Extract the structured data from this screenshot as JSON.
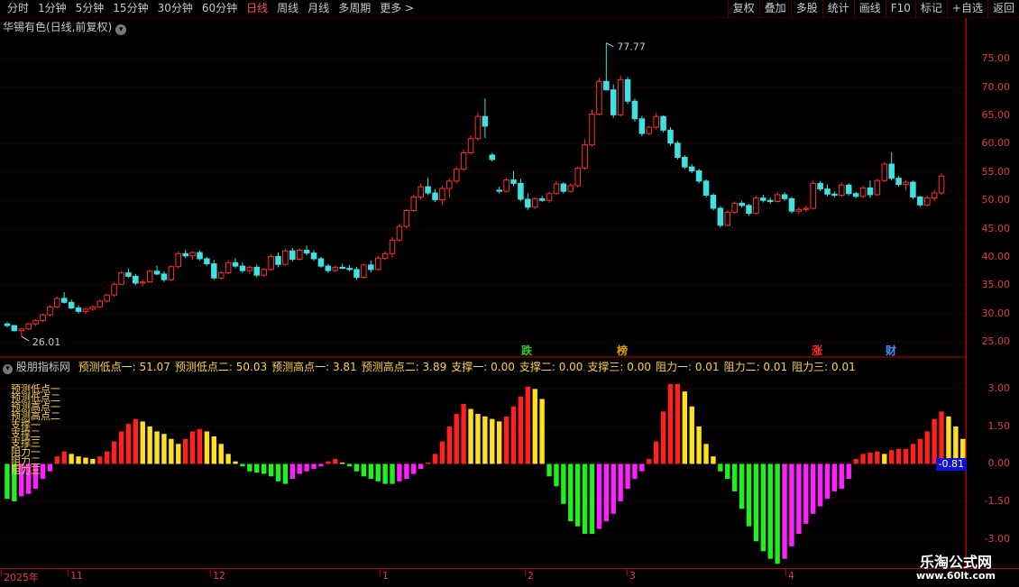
{
  "toolbar": {
    "periods": [
      "分时",
      "1分钟",
      "5分钟",
      "15分钟",
      "30分钟",
      "60分钟",
      "日线",
      "周线",
      "月线",
      "多周期",
      "更多 >"
    ],
    "active_period": "日线",
    "right_buttons": [
      "复权",
      "叠加",
      "多股",
      "统计",
      "画线",
      "F10",
      "标记",
      "+自选",
      "返回"
    ]
  },
  "chart_title": "华锡有色(日线,前复权)",
  "indicator": {
    "name": "股朋指标网",
    "values": [
      {
        "k": "预测低点一",
        "v": "51.07"
      },
      {
        "k": "预测低点二",
        "v": "50.03"
      },
      {
        "k": "预测高点一",
        "v": "3.81"
      },
      {
        "k": "预测高点二",
        "v": "3.89"
      },
      {
        "k": "支撑一",
        "v": "0.00"
      },
      {
        "k": "支撑二",
        "v": "0.00"
      },
      {
        "k": "支撑三",
        "v": "0.00"
      },
      {
        "k": "阻力一",
        "v": "0.01"
      },
      {
        "k": "阻力二",
        "v": "0.01"
      },
      {
        "k": "阻力三",
        "v": "0.01"
      }
    ],
    "current": "-0.81"
  },
  "price_axis": [
    "75.00",
    "70.00",
    "65.00",
    "60.00",
    "55.00",
    "50.00",
    "45.00",
    "40.00",
    "35.00",
    "30.00",
    "25.00"
  ],
  "ind_axis": [
    "3.00",
    "1.50",
    "0.00",
    "-1.50",
    "-3.00"
  ],
  "annotations": {
    "high": "77.77",
    "low": "26.01"
  },
  "event_tags": [
    {
      "text": "跌",
      "color": "#30d030"
    },
    {
      "text": "榜",
      "color": "#e0a000"
    },
    {
      "text": "涨",
      "color": "#ff3030"
    },
    {
      "text": "财",
      "color": "#4090ff"
    }
  ],
  "x_labels": [
    "2025年",
    "11",
    "12",
    "1",
    "2",
    "3",
    "4"
  ],
  "watermark": {
    "line1": "乐淘公式网",
    "line2": "www.60lt.com"
  },
  "colors": {
    "up": "#ff3030",
    "down": "#40e0e0",
    "grid": "#6a0000"
  },
  "chart_data": {
    "type": "candlestick",
    "ohlc": [
      [
        28.2,
        28.5,
        27.6,
        27.9
      ],
      [
        27.9,
        28.0,
        26.9,
        27.0
      ],
      [
        27.0,
        27.5,
        26.01,
        27.3
      ],
      [
        27.3,
        28.4,
        27.1,
        28.2
      ],
      [
        28.2,
        29.0,
        27.8,
        28.8
      ],
      [
        28.8,
        30.0,
        28.5,
        29.8
      ],
      [
        29.8,
        31.5,
        29.5,
        31.2
      ],
      [
        31.2,
        33.0,
        31.0,
        32.7
      ],
      [
        32.7,
        33.8,
        31.8,
        32.0
      ],
      [
        32.0,
        32.5,
        30.8,
        31.0
      ],
      [
        31.0,
        31.5,
        30.0,
        30.4
      ],
      [
        30.4,
        31.0,
        30.0,
        30.8
      ],
      [
        30.8,
        31.5,
        30.5,
        31.2
      ],
      [
        31.2,
        32.5,
        31.0,
        32.2
      ],
      [
        32.2,
        33.5,
        32.0,
        33.3
      ],
      [
        33.3,
        35.5,
        33.0,
        35.2
      ],
      [
        35.2,
        37.5,
        35.0,
        37.2
      ],
      [
        37.2,
        38.0,
        36.3,
        36.6
      ],
      [
        36.6,
        37.0,
        35.0,
        35.4
      ],
      [
        35.4,
        36.0,
        34.8,
        35.6
      ],
      [
        35.6,
        37.8,
        35.4,
        37.5
      ],
      [
        37.5,
        38.5,
        36.8,
        37.0
      ],
      [
        37.0,
        37.5,
        35.6,
        36.0
      ],
      [
        36.0,
        38.5,
        35.8,
        38.3
      ],
      [
        38.3,
        41.0,
        38.0,
        40.6
      ],
      [
        40.6,
        41.3,
        39.8,
        40.2
      ],
      [
        40.2,
        41.0,
        39.5,
        40.8
      ],
      [
        40.8,
        41.2,
        39.4,
        39.7
      ],
      [
        39.7,
        40.0,
        38.5,
        38.8
      ],
      [
        38.8,
        39.5,
        36.0,
        36.3
      ],
      [
        36.3,
        37.5,
        36.0,
        37.2
      ],
      [
        37.2,
        39.5,
        37.0,
        39.0
      ],
      [
        39.0,
        39.8,
        38.0,
        38.4
      ],
      [
        38.4,
        39.0,
        37.2,
        37.6
      ],
      [
        37.6,
        38.5,
        37.0,
        38.2
      ],
      [
        38.2,
        38.7,
        36.4,
        36.8
      ],
      [
        36.8,
        38.0,
        36.5,
        37.8
      ],
      [
        37.8,
        40.5,
        37.6,
        40.1
      ],
      [
        40.1,
        40.8,
        38.2,
        38.7
      ],
      [
        38.7,
        41.5,
        38.5,
        41.1
      ],
      [
        41.1,
        41.6,
        39.2,
        39.6
      ],
      [
        39.6,
        41.5,
        39.4,
        41.2
      ],
      [
        41.2,
        42.0,
        40.3,
        40.7
      ],
      [
        40.7,
        41.2,
        39.3,
        39.7
      ],
      [
        39.7,
        40.0,
        38.1,
        38.4
      ],
      [
        38.4,
        38.8,
        37.2,
        37.6
      ],
      [
        37.6,
        38.5,
        37.3,
        38.2
      ],
      [
        38.2,
        38.8,
        37.9,
        38.0
      ],
      [
        38.0,
        38.6,
        37.4,
        37.8
      ],
      [
        37.8,
        38.3,
        36.0,
        36.4
      ],
      [
        36.4,
        38.8,
        36.2,
        38.6
      ],
      [
        38.6,
        39.4,
        37.3,
        37.8
      ],
      [
        37.8,
        40.2,
        37.6,
        39.8
      ],
      [
        39.8,
        41.0,
        39.5,
        40.6
      ],
      [
        40.6,
        43.5,
        39.9,
        43.0
      ],
      [
        43.0,
        45.8,
        42.7,
        45.4
      ],
      [
        45.4,
        48.5,
        45.0,
        48.2
      ],
      [
        48.2,
        51.0,
        48.0,
        50.6
      ],
      [
        50.6,
        53.0,
        50.0,
        52.4
      ],
      [
        52.4,
        54.0,
        50.9,
        51.3
      ],
      [
        51.3,
        52.0,
        49.7,
        50.1
      ],
      [
        50.1,
        52.6,
        49.2,
        52.1
      ],
      [
        52.1,
        53.9,
        50.5,
        53.4
      ],
      [
        53.4,
        56.0,
        53.0,
        55.5
      ],
      [
        55.5,
        59.0,
        55.2,
        58.4
      ],
      [
        58.4,
        61.5,
        58.1,
        60.9
      ],
      [
        60.9,
        65.5,
        60.5,
        64.8
      ],
      [
        64.8,
        68.0,
        61.0,
        63.1
      ],
      [
        58.0,
        58.4,
        56.9,
        57.2
      ],
      [
        51.8,
        52.4,
        51.2,
        51.6
      ],
      [
        51.6,
        54.0,
        51.4,
        53.6
      ],
      [
        53.6,
        55.2,
        52.5,
        53.0
      ],
      [
        53.0,
        53.8,
        49.8,
        50.2
      ],
      [
        50.2,
        51.2,
        48.3,
        48.8
      ],
      [
        48.8,
        50.6,
        48.5,
        50.3
      ],
      [
        50.3,
        50.8,
        49.7,
        50.0
      ],
      [
        50.0,
        51.5,
        49.6,
        51.2
      ],
      [
        51.2,
        53.4,
        51.0,
        52.9
      ],
      [
        52.9,
        53.2,
        51.2,
        51.6
      ],
      [
        51.6,
        53.0,
        51.4,
        52.6
      ],
      [
        52.6,
        56.0,
        52.3,
        55.7
      ],
      [
        55.7,
        60.8,
        55.4,
        59.8
      ],
      [
        59.8,
        66.0,
        59.5,
        65.2
      ],
      [
        65.2,
        71.6,
        65.0,
        71.0
      ],
      [
        71.0,
        77.77,
        70.7,
        69.5
      ],
      [
        69.5,
        70.5,
        64.5,
        65.1
      ],
      [
        65.1,
        72.0,
        64.8,
        71.3
      ],
      [
        71.3,
        71.8,
        67.0,
        67.5
      ],
      [
        67.5,
        68.0,
        63.9,
        64.4
      ],
      [
        64.4,
        64.9,
        61.3,
        61.8
      ],
      [
        61.8,
        63.2,
        61.5,
        62.9
      ],
      [
        62.9,
        65.5,
        62.5,
        64.8
      ],
      [
        64.8,
        65.0,
        62.0,
        62.4
      ],
      [
        62.4,
        62.9,
        59.6,
        60.1
      ],
      [
        60.1,
        60.5,
        57.2,
        57.6
      ],
      [
        57.6,
        58.0,
        55.5,
        55.9
      ],
      [
        55.9,
        56.4,
        54.8,
        55.2
      ],
      [
        55.2,
        55.6,
        53.0,
        53.4
      ],
      [
        53.4,
        53.7,
        50.5,
        50.9
      ],
      [
        50.9,
        51.3,
        48.2,
        48.6
      ],
      [
        48.6,
        49.0,
        45.2,
        45.6
      ],
      [
        45.6,
        48.3,
        45.4,
        47.9
      ],
      [
        47.9,
        49.8,
        47.6,
        49.5
      ],
      [
        49.5,
        49.9,
        48.7,
        49.1
      ],
      [
        49.1,
        49.4,
        47.3,
        47.7
      ],
      [
        47.7,
        50.8,
        47.5,
        50.4
      ],
      [
        50.4,
        51.0,
        49.6,
        50.0
      ],
      [
        50.0,
        50.5,
        49.4,
        49.8
      ],
      [
        49.8,
        51.5,
        49.6,
        51.0
      ],
      [
        51.0,
        51.4,
        49.9,
        50.3
      ],
      [
        50.3,
        50.6,
        47.7,
        48.1
      ],
      [
        48.1,
        48.8,
        47.6,
        48.4
      ],
      [
        48.4,
        49.0,
        48.0,
        48.6
      ],
      [
        48.6,
        53.5,
        48.4,
        53.0
      ],
      [
        53.0,
        53.4,
        51.6,
        52.0
      ],
      [
        52.0,
        52.8,
        50.7,
        51.1
      ],
      [
        51.1,
        51.6,
        50.5,
        50.9
      ],
      [
        50.9,
        53.2,
        50.6,
        52.7
      ],
      [
        52.7,
        53.0,
        50.8,
        51.2
      ],
      [
        51.2,
        51.5,
        50.4,
        50.7
      ],
      [
        50.7,
        52.6,
        50.4,
        52.2
      ],
      [
        52.2,
        53.5,
        50.4,
        51.0
      ],
      [
        51.0,
        53.8,
        50.8,
        53.5
      ],
      [
        53.5,
        56.8,
        53.2,
        56.4
      ],
      [
        56.4,
        58.5,
        53.5,
        53.9
      ],
      [
        53.9,
        54.3,
        52.4,
        52.8
      ],
      [
        52.8,
        53.6,
        51.8,
        53.2
      ],
      [
        53.2,
        53.5,
        50.2,
        50.6
      ],
      [
        50.6,
        50.8,
        48.8,
        49.2
      ],
      [
        49.2,
        50.8,
        48.9,
        50.4
      ],
      [
        50.4,
        51.8,
        49.9,
        51.3
      ],
      [
        51.3,
        54.8,
        51.0,
        54.3
      ]
    ],
    "indicator_bars": [
      -1.4,
      -1.5,
      -1.3,
      -1.2,
      -1.0,
      -0.6,
      -0.3,
      0.3,
      0.5,
      0.4,
      0.3,
      0.25,
      0.2,
      0.3,
      0.5,
      0.9,
      1.3,
      1.6,
      1.8,
      1.7,
      1.5,
      1.3,
      1.2,
      1.0,
      0.8,
      1.0,
      1.3,
      1.4,
      1.3,
      1.1,
      0.8,
      0.4,
      0.1,
      -0.1,
      -0.3,
      -0.35,
      -0.4,
      -0.5,
      -0.7,
      -0.8,
      -0.6,
      -0.4,
      -0.3,
      -0.2,
      -0.1,
      0.1,
      0.2,
      0.05,
      -0.1,
      -0.3,
      -0.5,
      -0.6,
      -0.7,
      -0.8,
      -0.8,
      -0.7,
      -0.6,
      -0.4,
      -0.2,
      0.05,
      0.4,
      0.9,
      1.5,
      2.0,
      2.4,
      2.2,
      2.0,
      1.9,
      1.8,
      1.7,
      1.9,
      2.3,
      2.7,
      3.1,
      3.0,
      2.6,
      -0.5,
      -0.9,
      -1.6,
      -2.3,
      -2.5,
      -2.8,
      -2.8,
      -2.6,
      -2.3,
      -2.0,
      -1.5,
      -1.0,
      -0.6,
      -0.3,
      0.2,
      0.9,
      2.1,
      3.2,
      3.2,
      2.9,
      2.3,
      1.5,
      0.8,
      0.3,
      -0.3,
      -0.6,
      -1.1,
      -1.8,
      -2.5,
      -3.1,
      -3.5,
      -3.8,
      -4.0,
      -3.8,
      -3.3,
      -2.8,
      -2.4,
      -2.0,
      -1.7,
      -1.4,
      -1.1,
      -1.0,
      -0.6,
      0.2,
      0.4,
      0.45,
      0.5,
      0.4,
      0.55,
      0.6,
      0.6,
      0.8,
      1.0,
      1.3,
      1.8,
      2.1,
      1.9,
      1.5,
      1.0,
      0.4,
      0.15,
      0.05,
      0.3
    ]
  }
}
